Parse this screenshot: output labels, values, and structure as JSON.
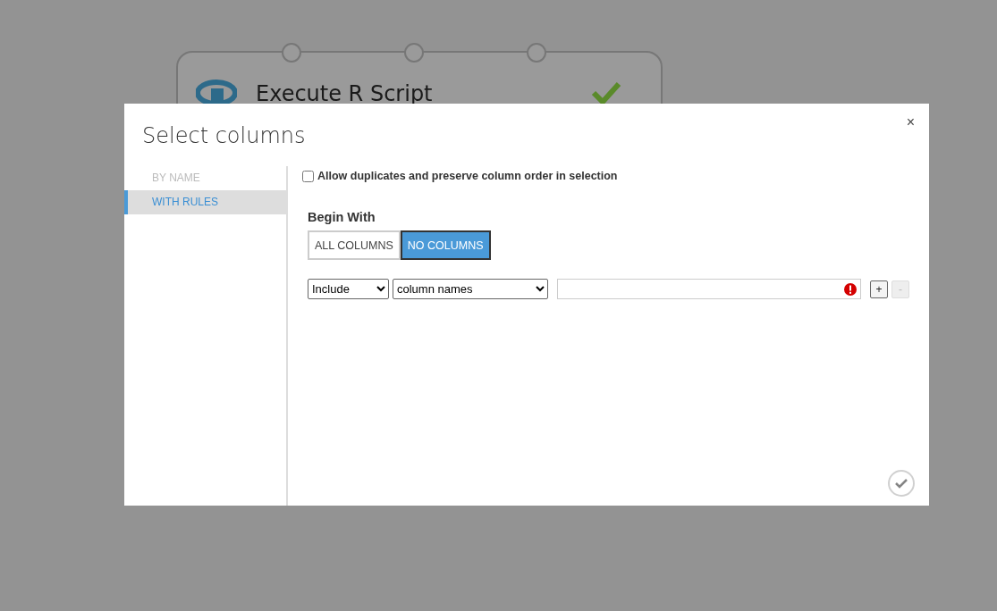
{
  "background_node": {
    "title": "Execute R Script",
    "completed": true
  },
  "dialog": {
    "title": "Select columns",
    "close": "×",
    "sidebar": {
      "items": [
        {
          "label": "BY NAME",
          "selected": false
        },
        {
          "label": "WITH RULES",
          "selected": true
        }
      ]
    },
    "allow_duplicates": {
      "label": "Allow duplicates and preserve column order in selection",
      "checked": false
    },
    "begin_with": {
      "label": "Begin With",
      "options": [
        {
          "label": "ALL COLUMNS",
          "selected": false
        },
        {
          "label": "NO COLUMNS",
          "selected": true
        }
      ]
    },
    "rules": [
      {
        "operator": "Include",
        "target": "column names",
        "error": true,
        "add": {
          "label": "+",
          "disabled": false
        },
        "remove": {
          "label": "-",
          "disabled": true
        }
      }
    ],
    "confirm": {
      "disabled": true
    }
  }
}
